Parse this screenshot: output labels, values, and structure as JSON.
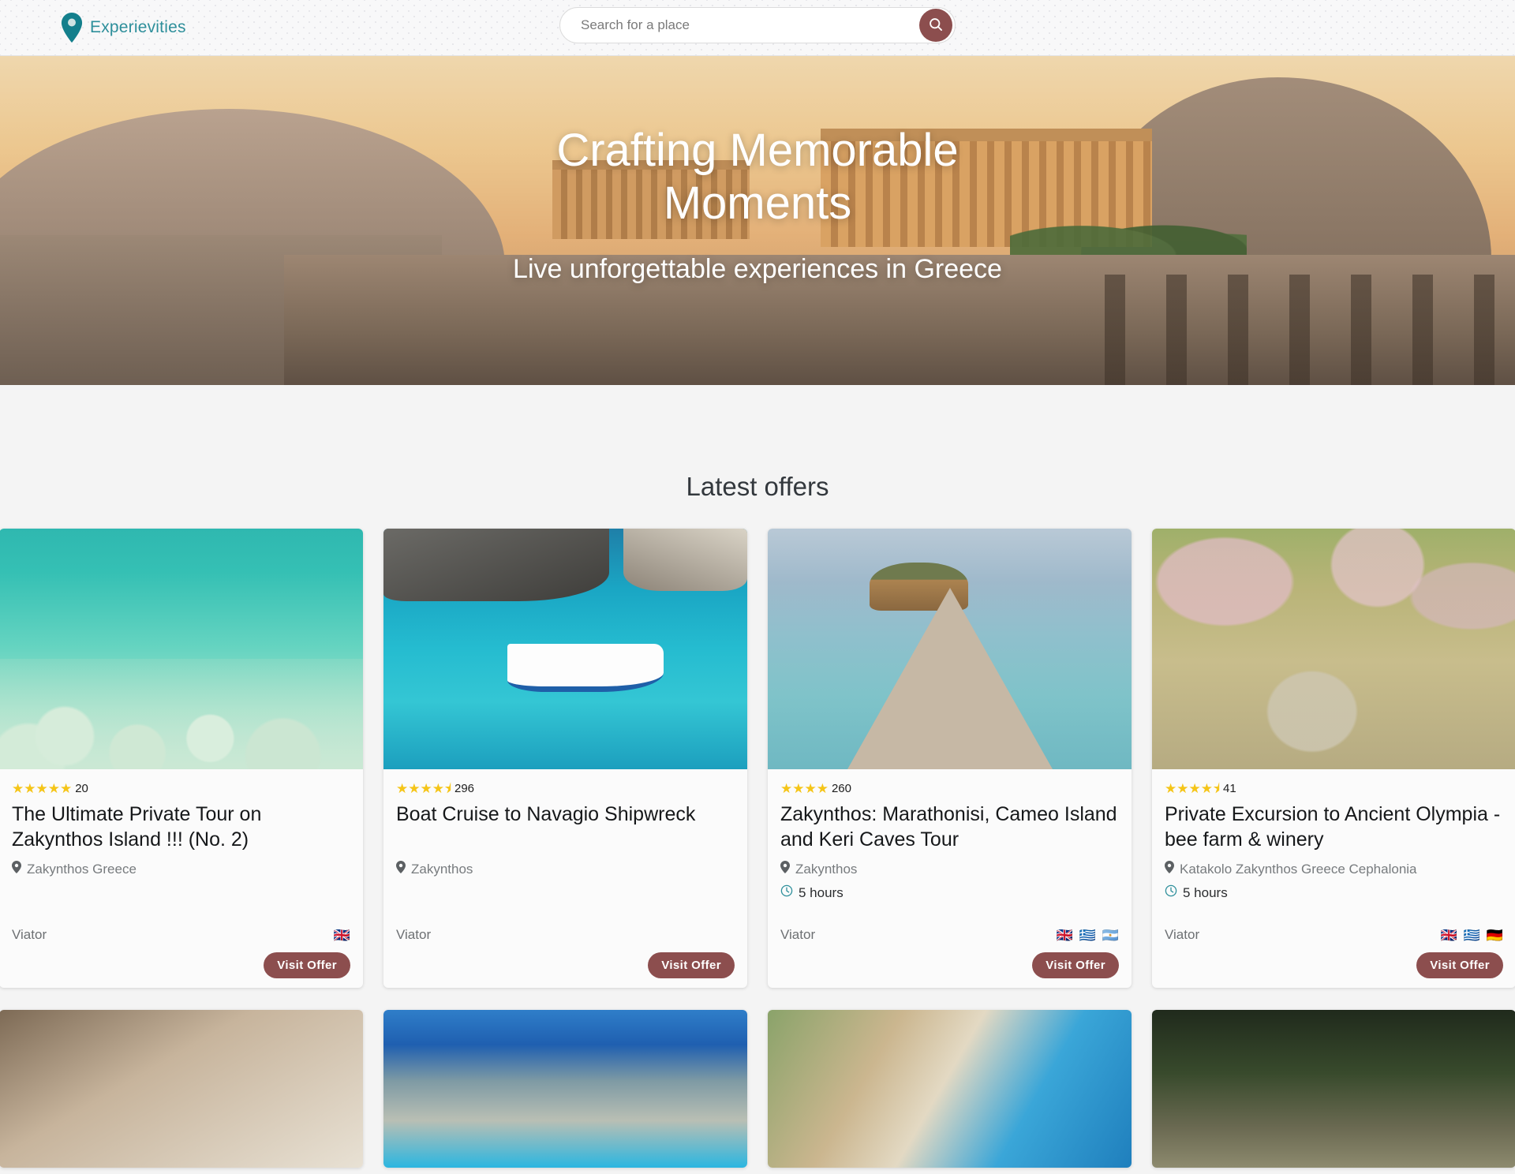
{
  "header": {
    "logo_text": "Experievities",
    "logo_icon": "map-pin-icon",
    "search": {
      "placeholder": "Search for a place",
      "value": "",
      "button_icon": "search-icon"
    }
  },
  "hero": {
    "title": "Crafting Memorable Moments",
    "subtitle": "Live unforgettable experiences in Greece",
    "image_alt": "acropolis-parthenon-sunset"
  },
  "main": {
    "section_title": "Latest offers",
    "visit_button_label": "Visit Offer",
    "cards": [
      {
        "stars": "★★★★★",
        "rating": 5,
        "reviews": "20",
        "title": "The Ultimate Private Tour on Zakynthos Island !!! (No. 2)",
        "location": "Zakynthos Greece",
        "duration": "",
        "provider": "Viator",
        "flags": [
          "🇬🇧"
        ],
        "image_alt": "snorkeling-turquoise-water"
      },
      {
        "stars": "★★★★⯨",
        "rating": 4.5,
        "reviews": "296",
        "title": "Boat Cruise to Navagio Shipwreck",
        "location": "Zakynthos",
        "duration": "",
        "provider": "Viator",
        "flags": [],
        "image_alt": "tour-boat-blue-lagoon"
      },
      {
        "stars": "★★★★",
        "rating": 4,
        "reviews": "260",
        "title": "Zakynthos: Marathonisi, Cameo Island and Keri Caves Tour",
        "location": "Zakynthos",
        "duration": "5 hours",
        "provider": "Viator",
        "flags": [
          "🇬🇧",
          "🇬🇷",
          "🇦🇷"
        ],
        "image_alt": "cameo-island-wooden-bridge"
      },
      {
        "stars": "★★★★⯨",
        "rating": 4.5,
        "reviews": "41",
        "title": "Private Excursion to Ancient Olympia - bee farm & winery",
        "location": "Katakolo Zakynthos Greece Cephalonia",
        "duration": "5 hours",
        "provider": "Viator",
        "flags": [
          "🇬🇧",
          "🇬🇷",
          "🇩🇪"
        ],
        "image_alt": "ancient-olympia-ruins-blossom"
      }
    ],
    "cards_row2": [
      {
        "image_alt": "spa-massage-table"
      },
      {
        "image_alt": "navagio-cliff-beach"
      },
      {
        "image_alt": "aerial-beach-umbrellas"
      },
      {
        "image_alt": "olympic-flame-ceremony"
      }
    ]
  },
  "colors": {
    "accent": "#8c4e4e",
    "brand_teal": "#2e8f9b",
    "star": "#f5c518",
    "page_bg": "#f4f4f4"
  }
}
